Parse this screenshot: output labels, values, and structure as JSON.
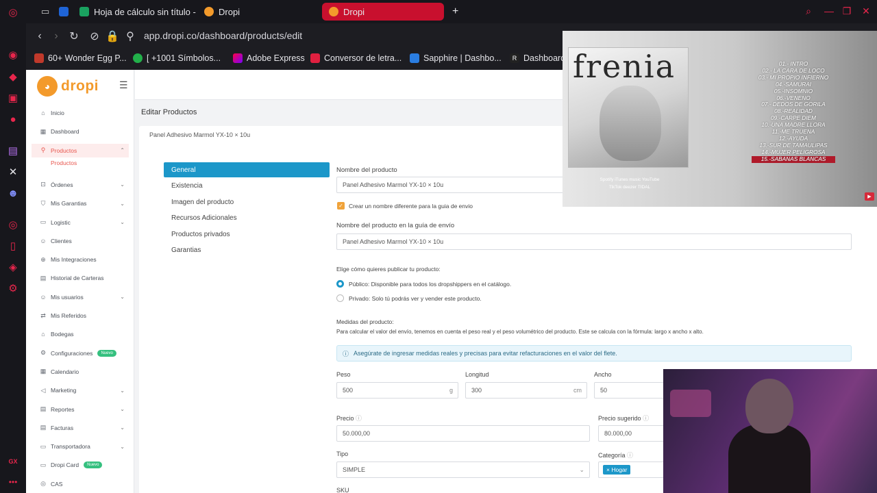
{
  "browser": {
    "tabs": [
      {
        "label": "Hoja de cálculo sin título -"
      },
      {
        "label": "Dropi"
      },
      {
        "label": "Dropi"
      }
    ],
    "new_tab": "+",
    "url": "app.dropi.co/dashboard/products/edit",
    "bookmarks": [
      {
        "label": "60+ Wonder Egg P..."
      },
      {
        "label": "[ +1001 Símbolos..."
      },
      {
        "label": "Adobe Express"
      },
      {
        "label": "Conversor de letra..."
      },
      {
        "label": "Sapphire | Dashbo..."
      },
      {
        "label": "Dashboard"
      }
    ]
  },
  "app": {
    "logo": "dropi",
    "sidebar": [
      {
        "label": "Inicio",
        "icon": "home-icon"
      },
      {
        "label": "Dashboard",
        "icon": "dashboard-icon"
      },
      {
        "label": "Productos",
        "icon": "search-icon"
      },
      {
        "label": "Órdenes",
        "icon": "cart-icon"
      },
      {
        "label": "Mis Garantias",
        "icon": "shield-icon"
      },
      {
        "label": "Logistic",
        "icon": "truck-icon"
      },
      {
        "label": "Clientes",
        "icon": "users-icon"
      },
      {
        "label": "Mis Integraciones",
        "icon": "plug-icon"
      },
      {
        "label": "Historial de Carteras",
        "icon": "wallet-icon"
      },
      {
        "label": "Mis usuarios",
        "icon": "user-icon"
      },
      {
        "label": "Mis Referidos",
        "icon": "share-icon"
      },
      {
        "label": "Bodegas",
        "icon": "warehouse-icon"
      },
      {
        "label": "Configuraciones",
        "icon": "gear-icon",
        "badge": "Nuevo"
      },
      {
        "label": "Calendario",
        "icon": "calendar-icon"
      },
      {
        "label": "Marketing",
        "icon": "megaphone-icon"
      },
      {
        "label": "Reportes",
        "icon": "report-icon"
      },
      {
        "label": "Facturas",
        "icon": "invoice-icon"
      },
      {
        "label": "Transportadora",
        "icon": "transport-icon"
      },
      {
        "label": "Dropi Card",
        "icon": "card-icon",
        "badge": "Nuevo"
      },
      {
        "label": "CAS",
        "icon": "cas-icon"
      }
    ],
    "sidebar_sub": "Productos",
    "page_title": "Editar Productos",
    "breadcrumb_product": "Panel Adhesivo Marmol YX-10 × 10u",
    "vertical_tabs": [
      "General",
      "Existencia",
      "Imagen del producto",
      "Recursos Adicionales",
      "Productos privados",
      "Garantias"
    ],
    "form": {
      "name_label": "Nombre del producto",
      "name_value": "Panel Adhesivo Marmol YX-10 × 10u",
      "checkbox_label": "Crear un nombre diferente para la guia de envio",
      "guide_label": "Nombre del producto en la guía de envío",
      "guide_value": "Panel Adhesivo Marmol YX-10 × 10u",
      "publish_label": "Elige cómo quieres publicar tu producto:",
      "public_label": "Público:",
      "public_desc": "Disponible para todos los dropshippers en el catálogo.",
      "private_label": "Privado:",
      "private_desc": "Solo tú podrás ver y vender este producto.",
      "measures_label": "Medidas del producto:",
      "measures_desc": "Para calcular el valor del envío, tenemos en cuenta el peso real y el peso volumétrico del producto. Este se calcula con la fórmula: largo x ancho x alto.",
      "alert": "Asegúrate de ingresar medidas reales y precisas para evitar refacturaciones en el valor del flete.",
      "peso_label": "Peso",
      "peso_value": "500",
      "peso_unit": "g",
      "longitud_label": "Longitud",
      "longitud_value": "300",
      "longitud_unit": "cm",
      "ancho_label": "Ancho",
      "ancho_value": "50",
      "precio_label": "Precio",
      "precio_value": "50.000,00",
      "sugerido_label": "Precio sugerido",
      "sugerido_value": "80.000,00",
      "tipo_label": "Tipo",
      "tipo_value": "SIMPLE",
      "categoria_label": "Categoría",
      "categoria_tag": "Hogar",
      "sku_label": "SKU"
    }
  },
  "album": {
    "cover_title": "frenia",
    "tracks": [
      "01.- INTRO",
      "02.- LA CARA DE LOCO",
      "03.- MI PROPIO INFIERNO",
      "04.-SAMURAI",
      "05.-INSOMNIO",
      "06.-VENENO",
      "07.- DEDOS DE GORILA",
      "08.-REALIDAD",
      "09.-CARPE DIEM",
      "10.-UNA MADRE LLORA",
      "11.-ME TRUENA",
      "12.-AYUDA",
      "13.-SUR DE TAMAULIPAS",
      "14.-MUJER PELIGROSA",
      "15.-SABANAS BLANCAS"
    ],
    "platforms_row1": "Spotify   iTunes   music   YouTube",
    "platforms_row2": "TikTok   deezer   TIDAL"
  },
  "gx_label": "GX"
}
